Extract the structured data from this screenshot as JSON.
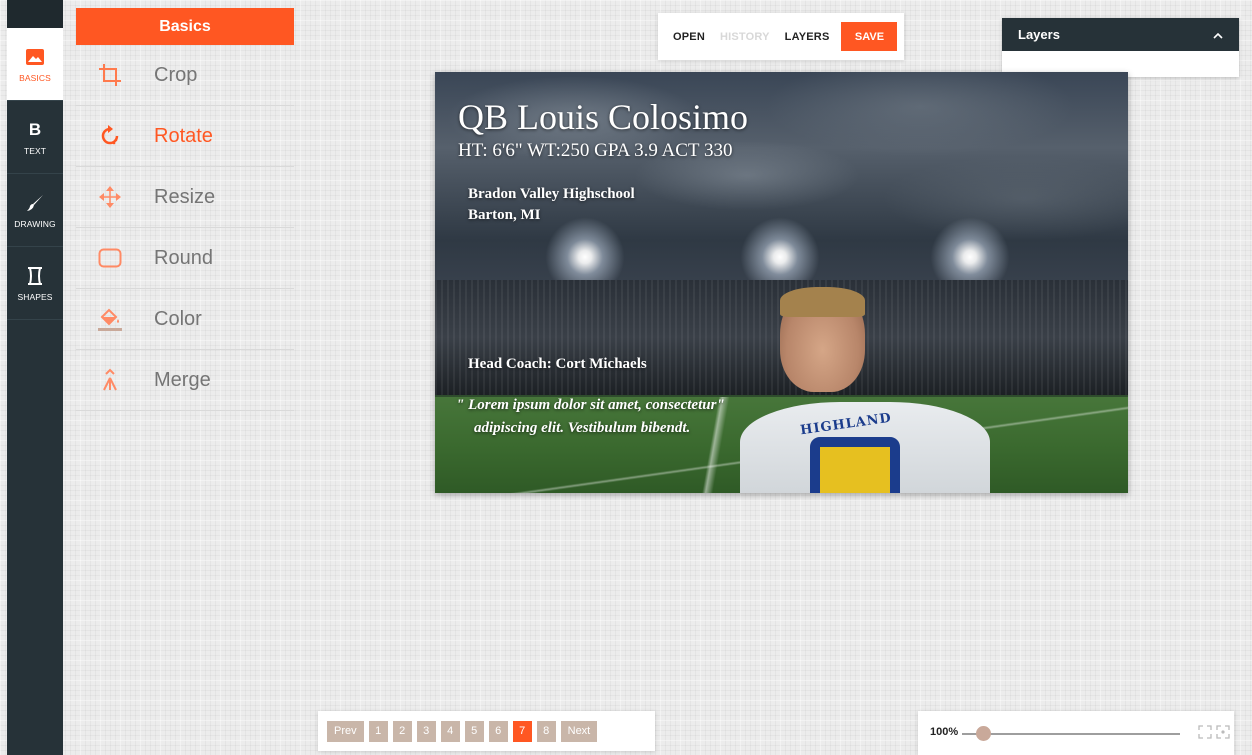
{
  "colors": {
    "accent": "#ff5722",
    "sidebar": "#263238",
    "pager_button": "#c9b6a9"
  },
  "sidebar": {
    "items": [
      {
        "label": "BASICS",
        "icon": "image-icon",
        "active": true
      },
      {
        "label": "TEXT",
        "icon": "bold-text-icon",
        "active": false
      },
      {
        "label": "DRAWING",
        "icon": "brush-icon",
        "active": false
      },
      {
        "label": "SHAPES",
        "icon": "shapes-icon",
        "active": false
      }
    ]
  },
  "panel": {
    "title": "Basics",
    "tools": [
      {
        "label": "Crop",
        "icon": "crop-icon",
        "active": false
      },
      {
        "label": "Rotate",
        "icon": "rotate-icon",
        "active": true
      },
      {
        "label": "Resize",
        "icon": "move-arrows-icon",
        "active": false
      },
      {
        "label": "Round",
        "icon": "rounded-rect-icon",
        "active": false
      },
      {
        "label": "Color",
        "icon": "paint-bucket-icon",
        "active": false
      },
      {
        "label": "Merge",
        "icon": "merge-icon",
        "active": false
      }
    ]
  },
  "toolbar": {
    "open": "OPEN",
    "history": "HISTORY",
    "layers": "LAYERS",
    "save": "SAVE"
  },
  "layers_panel": {
    "title": "Layers",
    "toggle_icon": "chevron-up-icon"
  },
  "canvas": {
    "title": "QB Louis Colosimo",
    "stats": "HT: 6'6\" WT:250 GPA 3.9 ACT 330",
    "school_line1": "Bradon Valley Highschool",
    "school_line2": "Barton, MI",
    "coach": "Head Coach: Cort Michaels",
    "quote_line1": "\" Lorem ipsum dolor sit amet, consectetur\"",
    "quote_line2": "adipiscing elit. Vestibulum bibendt.",
    "jersey_text": "HIGHLAND"
  },
  "pagination": {
    "prev": "Prev",
    "next": "Next",
    "pages": [
      "1",
      "2",
      "3",
      "4",
      "5",
      "6",
      "7",
      "8"
    ],
    "current": "7"
  },
  "zoom": {
    "value": "100%",
    "level": 0.1
  }
}
